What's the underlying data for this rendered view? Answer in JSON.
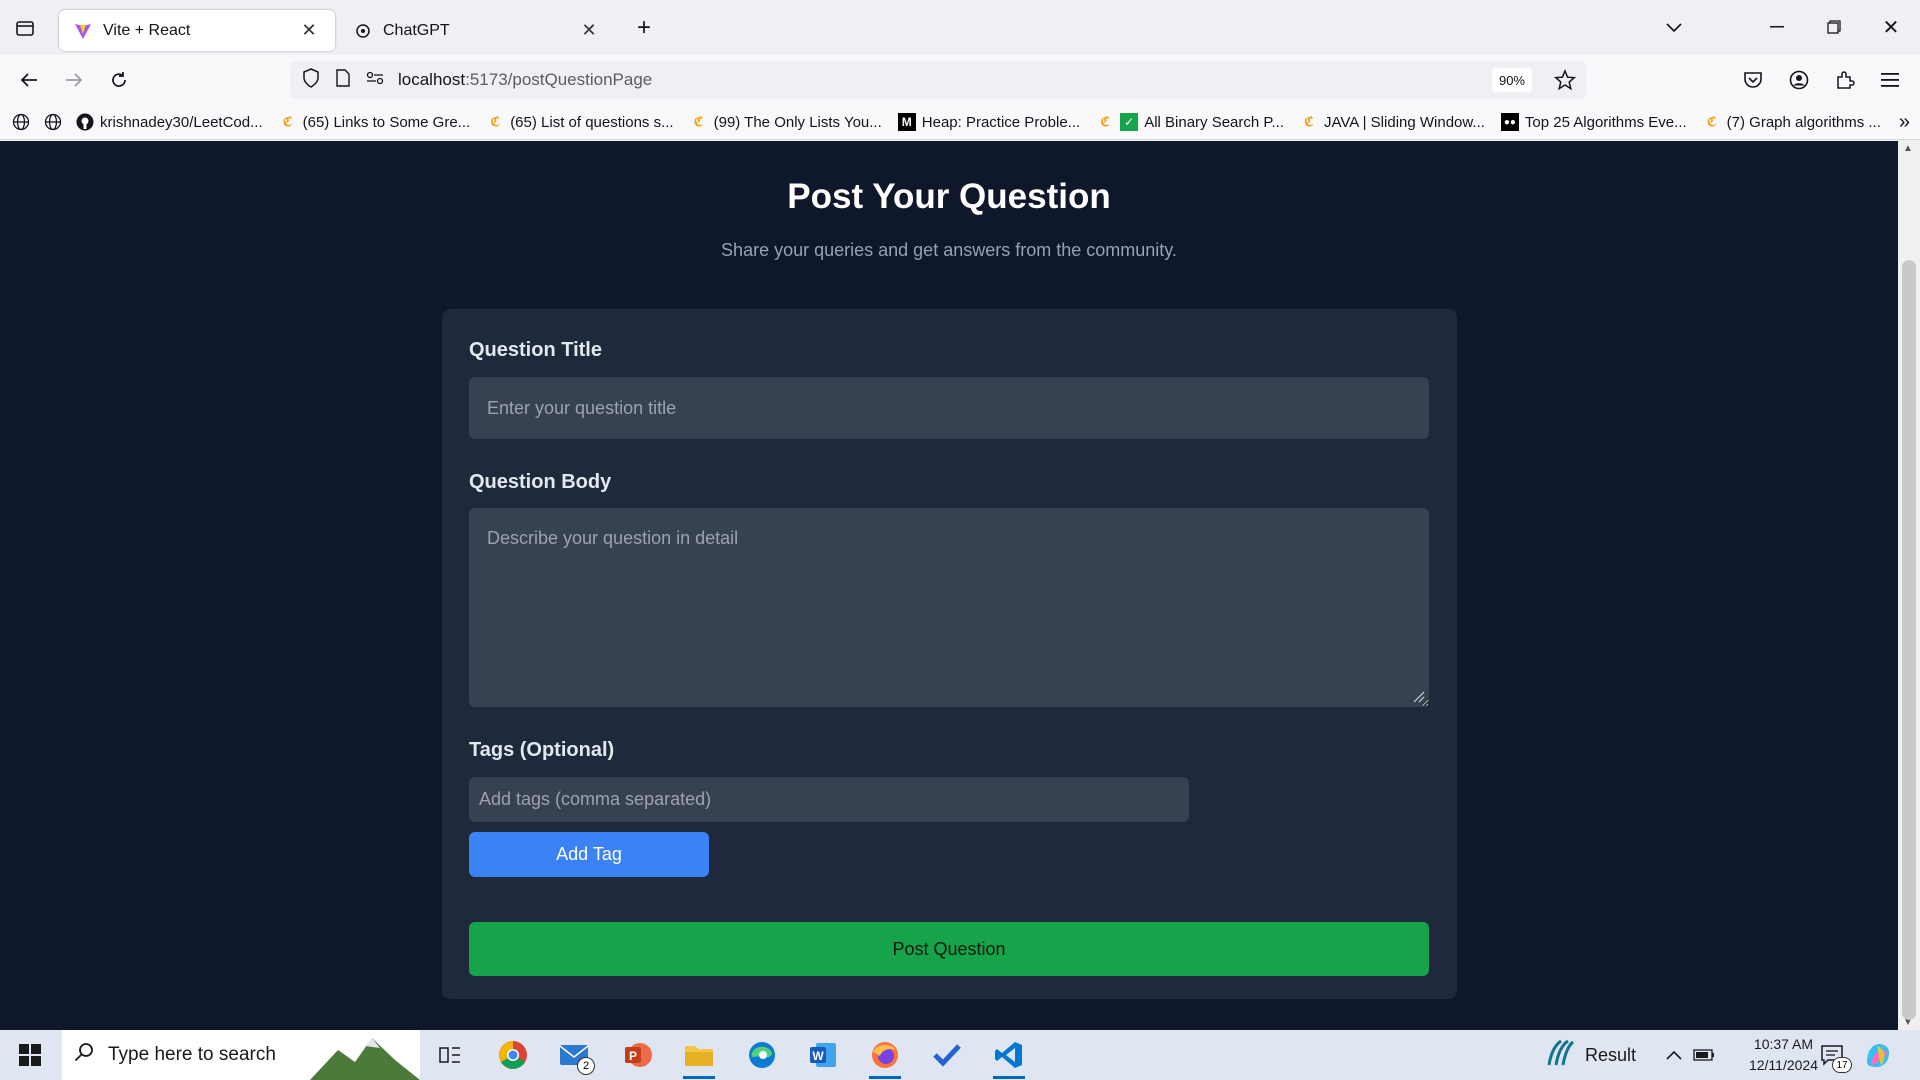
{
  "browser": {
    "tabs": [
      {
        "title": "Vite + React",
        "active": true
      },
      {
        "title": "ChatGPT",
        "active": false
      }
    ],
    "url_host": "localhost",
    "url_path": ":5173/postQuestionPage",
    "zoom": "90%",
    "bookmarks": [
      "krishnadey30/LeetCod...",
      "(65) Links to Some Gre...",
      "(65) List of questions s...",
      "(99) The Only Lists You...",
      "Heap: Practice Proble...",
      "All Binary Search P...",
      "JAVA | Sliding Window...",
      "Top 25 Algorithms Eve...",
      "(7) Graph algorithms ..."
    ]
  },
  "page": {
    "title": "Post Your Question",
    "subtitle": "Share your queries and get answers from the community.",
    "form": {
      "title_label": "Question Title",
      "title_placeholder": "Enter your question title",
      "body_label": "Question Body",
      "body_placeholder": "Describe your question in detail",
      "tags_label": "Tags (Optional)",
      "tags_placeholder": "Add tags (comma separated)",
      "add_tag_label": "Add Tag",
      "submit_label": "Post Question"
    }
  },
  "taskbar": {
    "search_placeholder": "Type here to search",
    "mail_badge": "2",
    "widget_label": "Result",
    "time": "10:37 AM",
    "date": "12/11/2024",
    "notification_count": "17"
  },
  "colors": {
    "page_bg": "#0f172a",
    "card_bg": "#1e293b",
    "input_bg": "#374151",
    "primary_button": "#3b82f6",
    "submit_button": "#16a34a"
  }
}
